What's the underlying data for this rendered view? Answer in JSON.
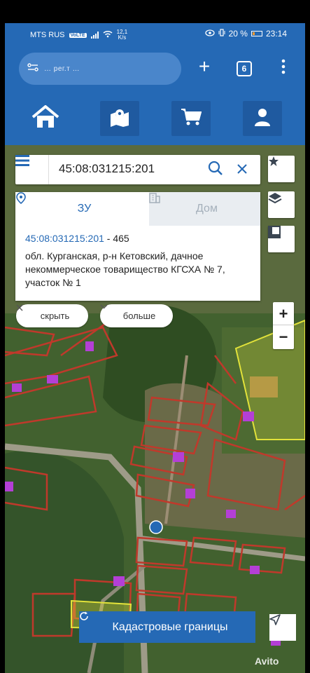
{
  "status_bar": {
    "carrier": "MTS RUS",
    "network_badge": "VoLTE",
    "speed": "12,1",
    "speed_unit": "K/s",
    "battery": "20 %",
    "time": "23:14"
  },
  "browser": {
    "url_text": "… рег.т …",
    "new_tab_label": "+",
    "tab_count": "6",
    "menu_label": "⋮"
  },
  "nav": {
    "items": [
      {
        "icon": "home-icon"
      },
      {
        "icon": "map-pin-icon"
      },
      {
        "icon": "cart-icon"
      },
      {
        "icon": "user-icon"
      }
    ]
  },
  "search": {
    "query": "45:08:031215:201"
  },
  "info": {
    "tab_parcel": "ЗУ",
    "tab_building": "Дом",
    "cadastral_number": "45:08:031215:201",
    "suffix": "- 465",
    "address": "обл. Курганская, р-н Кетовский, дачное некоммерческое товарищество КГСХА № 7, участок № 1"
  },
  "actions": {
    "hide_label": "скрыть",
    "more_label": "больше",
    "cadastre_label": "Кадастровые границы",
    "zoom_in": "+",
    "zoom_out": "−"
  },
  "watermark": "Avito",
  "colors": {
    "brand_blue": "#2569b5",
    "parcel_outline": "#c0392b",
    "building_fill": "#b43fd6",
    "highlight_yellow": "#e2e23a"
  }
}
